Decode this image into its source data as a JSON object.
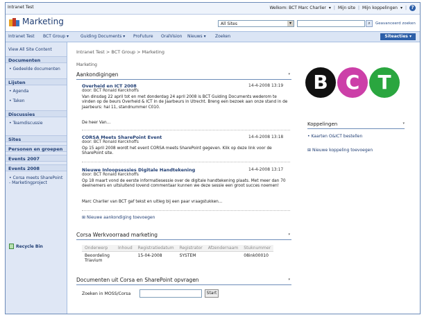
{
  "topbar": {
    "site": "Intranet Test",
    "welcome": "Welkom: BCT Marc Charlier",
    "mysite": "Mijn site",
    "mylinks": "Mijn koppelingen",
    "help": "?"
  },
  "header": {
    "title": "Marketing",
    "scope": "All Sites",
    "advanced": "Geavanceerd zoeken"
  },
  "nav": {
    "tabs": [
      "Intranet Test",
      "BCT Group",
      "Guiding Documents",
      "ProFuture",
      "OralVision",
      "Nieuws",
      "Zoeken"
    ],
    "site_actions": "Siteacties"
  },
  "leftnav": {
    "view_all": "View All Site Content",
    "documents_head": "Documenten",
    "documents": [
      "Gedeelde documenten"
    ],
    "lists_head": "Lijsten",
    "lists": [
      "Agenda",
      "Taken"
    ],
    "discussions_head": "Discussies",
    "discussions": [
      "Teamdiscussie"
    ],
    "sites_head": "Sites",
    "people_head": "Personen en groepen",
    "events2007_head": "Events 2007",
    "events2008_head": "Events 2008",
    "events2008": [
      "Corsa meets SharePoint - Marketingproject"
    ],
    "recycle": "Recycle Bin"
  },
  "main": {
    "breadcrumb": "Intranet Test > BCT Group > Marketing",
    "subtitle": "Marketing",
    "ann_title": "Aankondigingen",
    "announcements": [
      {
        "title": "Overheid en ICT 2008",
        "by": "door: BCT Ronald Kerckhoffs",
        "date": "14-4-2008 13:19",
        "body": "Van dinsdag 22 april tot en met donderdag 24 april 2008 is BCT Guiding Documents wederom te vinden op de beurs Overheid & ICT in de Jaarbeurs in Utrecht. Breng een bezoek aan onze stand in de Jaarbeurs: hal 11, standnummer C010.",
        "extra": "De heer Van..."
      },
      {
        "title": "CORSA Meets SharePoint Event",
        "by": "door: BCT Ronald Kerckhoffs",
        "date": "14-4-2008 13:18",
        "body": "Op 15 april 2008 wordt het event CORSA meets SharePoint gegeven. Klik op deze link voor de SharePoint site.",
        "extra": ""
      },
      {
        "title": "Nieuwe Inloopsessies Digitale Handtekening",
        "by": "door: BCT Ronald Kerckhoffs",
        "date": "14-4-2008 13:17",
        "body": "Op 18 maart vond de eerste informatiesessie over de digitale handtekening plaats. Met meer dan 70 deelnemers en uitsluitend lovend commentaar kunnen we deze sessie een groot succes noemen!",
        "extra": "Marc Charlier van BCT gaf tekst en uitleg bij een paar vraagstukken..."
      }
    ],
    "add_announcement": "Nieuwe aankondiging toevoegen",
    "work_title": "Corsa Werkvoorraad marketing",
    "work_columns": [
      "Onderwerp",
      "Inhoud",
      "Registratiedatum",
      "Registrator",
      "Afzendernaam",
      "Stuknummer"
    ],
    "work_rows": [
      [
        "Beoordeling Triavium",
        "",
        "15-04-2008",
        "SYSTEM",
        "",
        "08ink00010"
      ]
    ],
    "docs_title": "Documenten uit Corsa en SharePoint opvragen",
    "query_label": "Zoeken in MOSS/Corsa",
    "start": "Start"
  },
  "right": {
    "logo_letters": [
      "B",
      "C",
      "T"
    ],
    "colors": {
      "b": "#111111",
      "c": "#cc3fa8",
      "t": "#2aa63f"
    },
    "links_title": "Koppelingen",
    "links": [
      "Kaarten O&ICT bestellen"
    ],
    "add_link": "Nieuwe koppeling toevoegen"
  }
}
